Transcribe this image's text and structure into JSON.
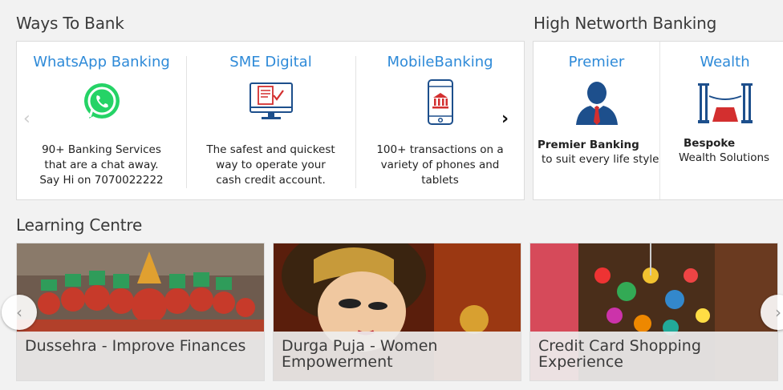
{
  "ways_to_bank": {
    "title": "Ways To Bank",
    "items": [
      {
        "title": "WhatsApp Banking",
        "desc": "90+ Banking Services that are a chat away. Say Hi on 7070022222"
      },
      {
        "title": "SME Digital",
        "desc": "The safest and quickest way to operate your cash credit account."
      },
      {
        "title": "MobileBanking",
        "desc": "100+ transactions on a variety of phones and tablets"
      }
    ],
    "prev_arrow": "‹",
    "next_arrow": "›"
  },
  "high_networth": {
    "title": "High Networth Banking",
    "items": [
      {
        "title": "Premier",
        "desc_bold": "Premier Banking",
        "desc": "to suit every life style"
      },
      {
        "title": "Wealth",
        "desc_bold": "Bespoke",
        "desc": "Wealth Solutions"
      }
    ]
  },
  "learning_centre": {
    "title": "Learning Centre",
    "tiles": [
      {
        "caption": "Dussehra - Improve Finances"
      },
      {
        "caption": "Durga Puja - Women Empowerment"
      },
      {
        "caption": "Credit Card Shopping Experience"
      }
    ],
    "prev_arrow": "‹",
    "next_arrow": "›"
  },
  "colors": {
    "link_blue": "#2e8ad8",
    "whatsapp_green": "#25d366",
    "accent_red": "#d32f2f",
    "navy": "#1d4f8c"
  }
}
